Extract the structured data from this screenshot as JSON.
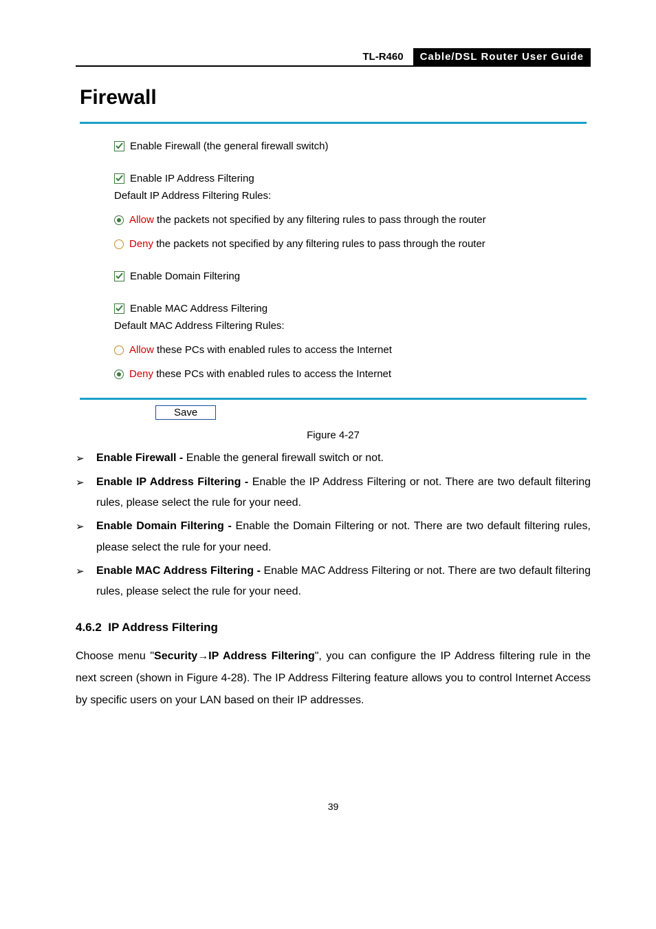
{
  "header": {
    "model": "TL-R460",
    "guide": "Cable/DSL  Router  User  Guide"
  },
  "panel": {
    "title": "Firewall",
    "enable_firewall_label": "Enable Firewall (the general firewall switch)",
    "enable_ip_label": "Enable IP Address Filtering",
    "ip_rules_heading": "Default IP Address Filtering Rules:",
    "ip_allow_word": "Allow",
    "ip_allow_rest": " the packets not specified by any filtering rules to pass through the router",
    "ip_deny_word": "Deny",
    "ip_deny_rest": " the packets not specified by any filtering rules to pass through the router",
    "enable_domain_label": "Enable Domain Filtering",
    "enable_mac_label": "Enable MAC Address Filtering",
    "mac_rules_heading": "Default MAC Address Filtering Rules:",
    "mac_allow_word": "Allow",
    "mac_allow_rest": " these PCs with enabled rules to access the Internet",
    "mac_deny_word": "Deny",
    "mac_deny_rest": " these PCs with enabled rules to access the Internet",
    "save_label": "Save"
  },
  "caption": "Figure 4-27",
  "bullets": {
    "b1_strong": "Enable Firewall - ",
    "b1_rest": "Enable the general firewall switch or not.",
    "b2_strong": "Enable IP Address Filtering - ",
    "b2_rest": "Enable the IP Address Filtering or not. There are two default filtering rules, please select the rule for your need.",
    "b3_strong": "Enable Domain Filtering - ",
    "b3_rest": "Enable the Domain Filtering or not. There are two default filtering rules, please select the rule for your need.",
    "b4_strong": "Enable MAC Address Filtering - ",
    "b4_rest": "Enable MAC Address Filtering or not. There are two default filtering rules, please select the rule for your need."
  },
  "section": {
    "num": "4.6.2",
    "title": "IP Address Filtering"
  },
  "para": {
    "p1_a": "Choose menu \"",
    "p1_sec": "Security",
    "p1_arrow": "→",
    "p1_ip": "IP Address Filtering",
    "p1_b": "\", you can configure the IP Address filtering rule in the next screen (shown in Figure 4-28). The IP Address Filtering feature allows you to control Internet Access by specific users on your LAN based on their IP addresses."
  },
  "page_number": "39"
}
